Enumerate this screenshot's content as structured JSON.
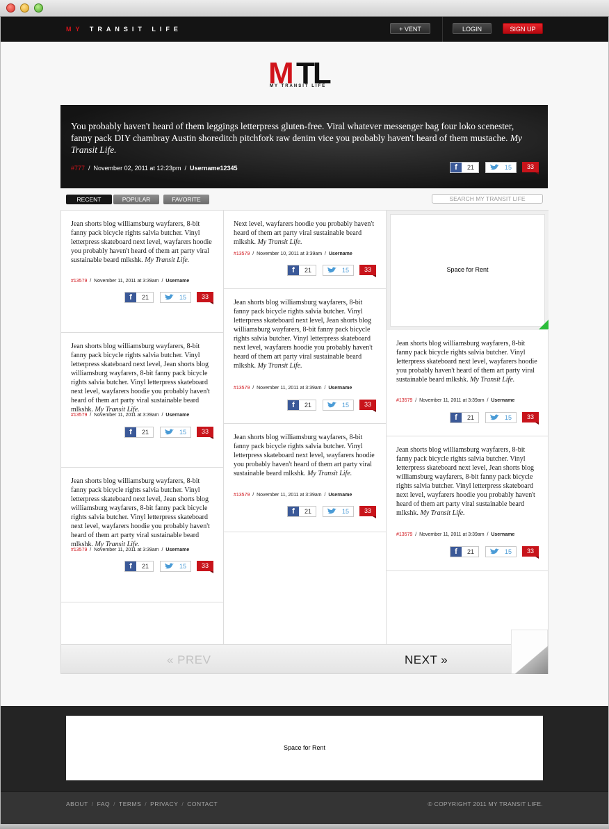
{
  "topbar": {
    "brand_my": "MY",
    "brand_rest": "TRANSIT LIFE",
    "vent_label": "+ VENT",
    "login_label": "LOGIN",
    "signup_label": "SIGN UP"
  },
  "logo": {
    "m": "M",
    "tl": "TL",
    "sub": "MY TRANSIT LIFE"
  },
  "hero": {
    "text": "You probably haven't heard of them leggings letterpress gluten-free. Viral whatever messenger bag four loko scenester, fanny pack DIY chambray Austin shoreditch pitchfork raw denim vice you probably haven't heard of them mustache.",
    "signature": "My Transit Life.",
    "id": "#777",
    "date": "November 02, 2011 at 12:23pm",
    "user": "Username12345",
    "fb": "21",
    "tw": "15",
    "comments": "33"
  },
  "tabs": {
    "recent": "RECENT",
    "popular": "POPULAR",
    "favorite": "FAVORITE"
  },
  "search": {
    "placeholder": "SEARCH MY TRANSIT LIFE"
  },
  "signature": "My Transit Life.",
  "posts": [
    {
      "text": "Jean shorts blog williamsburg wayfarers, 8-bit fanny pack bicycle rights salvia butcher. Vinyl letterpress skateboard next level, wayfarers hoodie you probably haven't heard of them art party viral sustainable beard mlkshk.",
      "id": "#13579",
      "date": "November 11, 2011 at 3:39am",
      "user": "Username",
      "fb": "21",
      "tw": "15",
      "comments": "33"
    },
    {
      "text": "Jean shorts blog williamsburg wayfarers, 8-bit fanny pack bicycle rights salvia butcher. Vinyl letterpress skateboard next level, Jean shorts blog williamsburg wayfarers, 8-bit fanny pack bicycle rights salvia butcher. Vinyl letterpress skateboard next level, wayfarers hoodie you probably haven't heard of them art party viral sustainable beard mlkshk.",
      "id": "#13579",
      "date": "November 11, 2011 at 3:39am",
      "user": "Username",
      "fb": "21",
      "tw": "15",
      "comments": "33"
    },
    {
      "text": "Jean shorts blog williamsburg wayfarers, 8-bit fanny pack bicycle rights salvia butcher. Vinyl letterpress skateboard next level, Jean shorts blog williamsburg wayfarers, 8-bit fanny pack bicycle rights salvia butcher. Vinyl letterpress skateboard next level, wayfarers hoodie you probably haven't heard of them art party viral sustainable beard mlkshk.",
      "id": "#13579",
      "date": "November 11, 2011 at 3:39am",
      "user": "Username",
      "fb": "21",
      "tw": "15",
      "comments": "33"
    },
    {
      "text": "Next level, wayfarers hoodie you probably haven't heard of them art party viral sustainable beard mlkshk.",
      "id": "#13579",
      "date": "November 10, 2011 at 3:39am",
      "user": "Username",
      "fb": "21",
      "tw": "15",
      "comments": "33"
    },
    {
      "text": "Jean shorts blog williamsburg wayfarers, 8-bit fanny pack bicycle rights salvia butcher. Vinyl letterpress skateboard next level, Jean shorts blog williamsburg wayfarers, 8-bit fanny pack bicycle rights salvia butcher. Vinyl letterpress skateboard next level, wayfarers hoodie you probably haven't heard of them art party viral sustainable beard mlkshk.",
      "id": "#13579",
      "date": "November 11, 2011 at 3:39am",
      "user": "Username",
      "fb": "21",
      "tw": "15",
      "comments": "33"
    },
    {
      "text": "Jean shorts blog williamsburg wayfarers, 8-bit fanny pack bicycle rights salvia butcher. Vinyl letterpress skateboard next level, wayfarers hoodie you probably haven't heard of them art party viral sustainable beard mlkshk.",
      "id": "#13579",
      "date": "November 11, 2011 at 3:39am",
      "user": "Username",
      "fb": "21",
      "tw": "15",
      "comments": "33"
    },
    {
      "text": "Jean shorts blog williamsburg wayfarers, 8-bit fanny pack bicycle rights salvia butcher. Vinyl letterpress skateboard next level, wayfarers hoodie you probably haven't heard of them art party viral sustainable beard mlkshk.",
      "id": "#13579",
      "date": "November 11, 2011 at 3:39am",
      "user": "Username",
      "fb": "21",
      "tw": "15",
      "comments": "33"
    },
    {
      "text": "Jean shorts blog williamsburg wayfarers, 8-bit fanny pack bicycle rights salvia butcher. Vinyl letterpress skateboard next level, Jean shorts blog williamsburg wayfarers, 8-bit fanny pack bicycle rights salvia butcher. Vinyl letterpress skateboard next level, wayfarers hoodie you probably haven't heard of them art party viral sustainable beard mlkshk.",
      "id": "#13579",
      "date": "November 11, 2011 at 3:39am",
      "user": "Username",
      "fb": "21",
      "tw": "15",
      "comments": "33"
    }
  ],
  "ad_side": "Space for Rent",
  "pager": {
    "prev": "« PREV",
    "next": "NEXT »"
  },
  "footer": {
    "ad": "Space for Rent",
    "links": [
      "ABOUT",
      "FAQ",
      "TERMS",
      "PRIVACY",
      "CONTACT"
    ],
    "separator": "/",
    "copyright": "© COPYRIGHT 2011 MY TRANSIT LIFE."
  },
  "colors": {
    "accent_red": "#d0141b",
    "facebook": "#3b5998",
    "twitter": "#4a9bd6",
    "ad_corner": "#2bbd3a"
  },
  "icons": {
    "facebook": "facebook-icon",
    "twitter": "twitter-bird-icon",
    "comments": "comment-bubble-icon"
  }
}
